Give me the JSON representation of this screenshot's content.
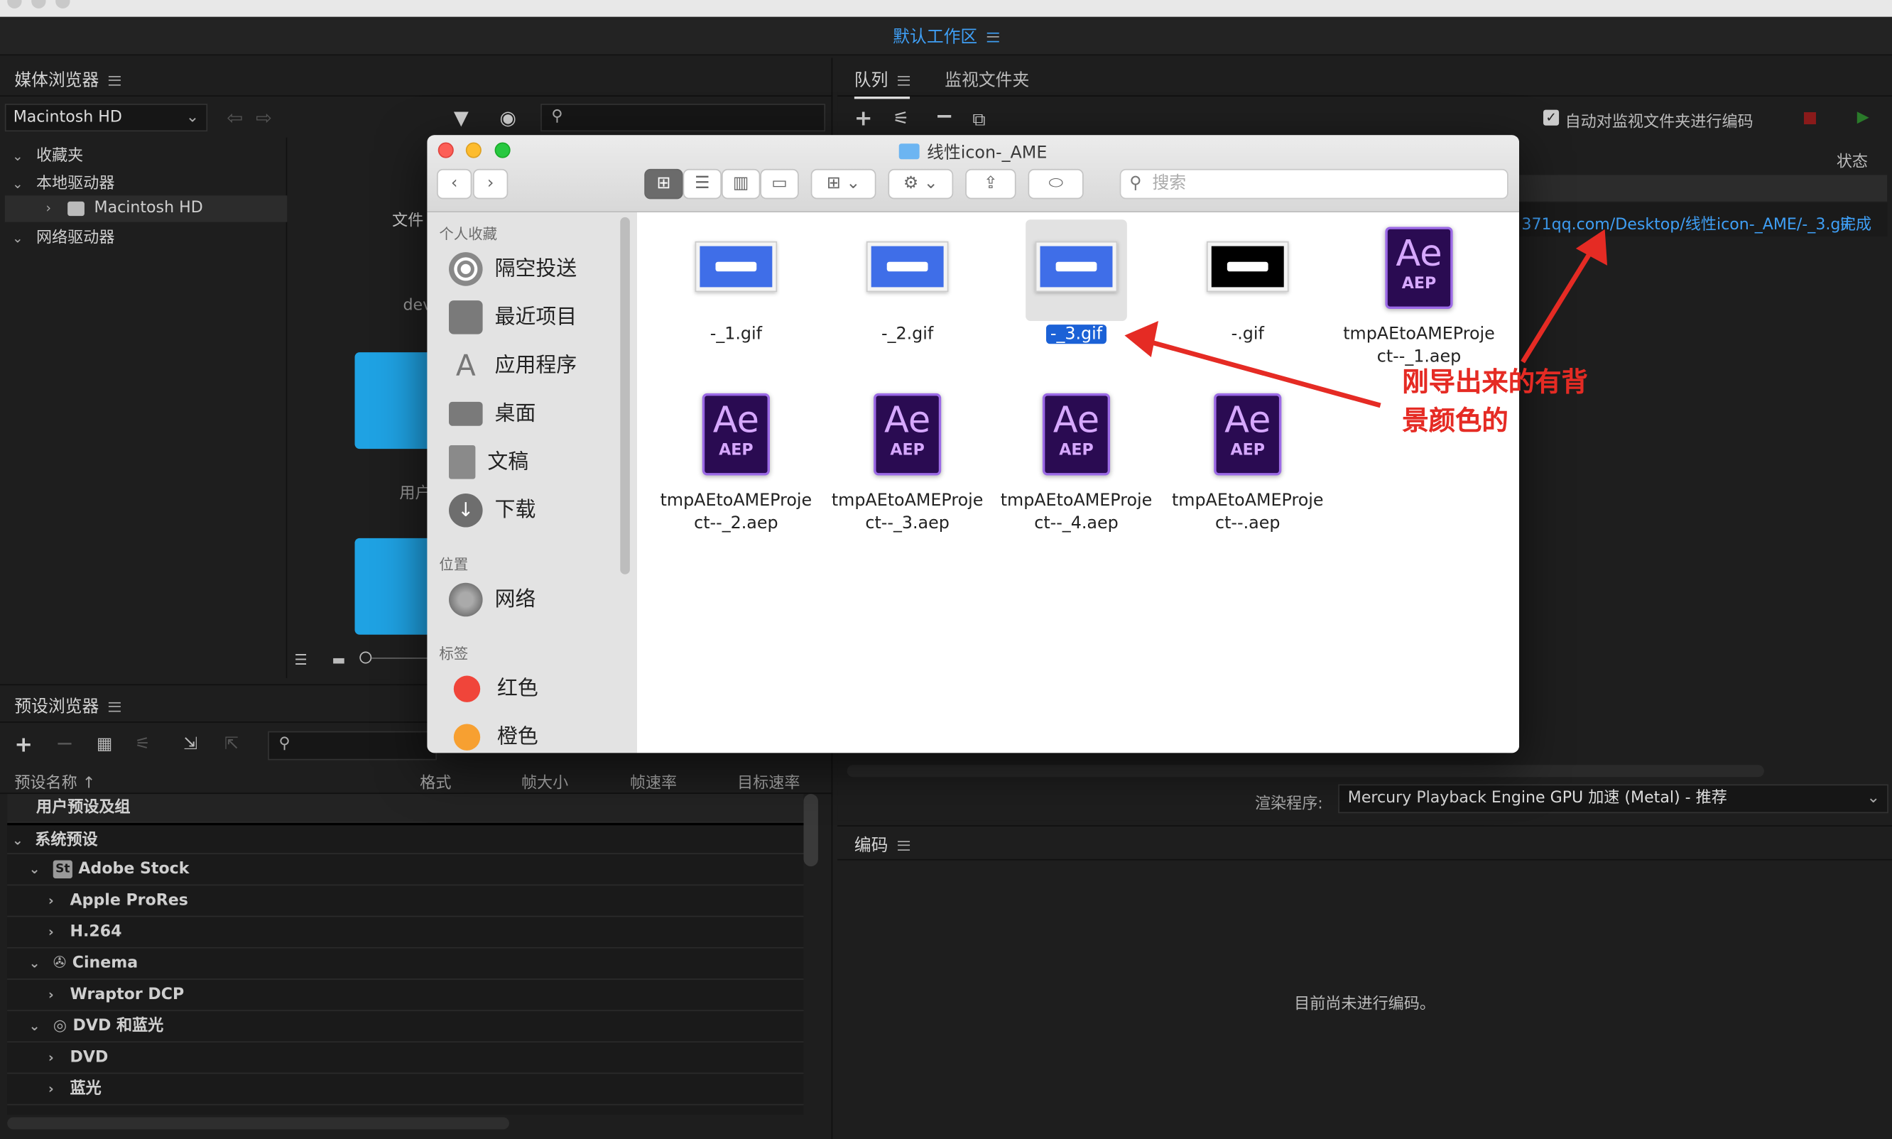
{
  "workspace": {
    "title": "默认工作区"
  },
  "media_browser": {
    "title": "媒体浏览器",
    "drive_select": "Macintosh HD",
    "tree": [
      {
        "label": "收藏夹"
      },
      {
        "label": "本地驱动器"
      },
      {
        "label": "Macintosh HD"
      },
      {
        "label": "网络驱动器"
      }
    ],
    "partial_labels": {
      "a": "文件",
      "b": "dev",
      "c": "用户"
    }
  },
  "queue": {
    "tabs": [
      {
        "label": "队列"
      },
      {
        "label": "监视文件夹"
      }
    ],
    "auto_encode_label": "自动对监视文件夹进行编码",
    "status_col": "状态",
    "output_path": "371qq.com/Desktop/线性icon-_AME/-_3.gif",
    "status": "完成",
    "renderer_label": "渲染程序:",
    "renderer_value": "Mercury Playback Engine GPU 加速 (Metal) - 推荐"
  },
  "encoding": {
    "title": "编码",
    "empty_text": "目前尚未进行编码。"
  },
  "preset_browser": {
    "title": "预设浏览器",
    "columns": [
      "预设名称 ↑",
      "格式",
      "帧大小",
      "帧速率",
      "目标速率"
    ],
    "rows": [
      {
        "label": "用户预设及组"
      },
      {
        "label": "系统预设"
      },
      {
        "label": "Adobe Stock"
      },
      {
        "label": "Apple ProRes"
      },
      {
        "label": "H.264"
      },
      {
        "label": "Cinema"
      },
      {
        "label": "Wraptor DCP"
      },
      {
        "label": "DVD 和蓝光"
      },
      {
        "label": "DVD"
      },
      {
        "label": "蓝光"
      }
    ]
  },
  "finder": {
    "title": "线性icon-_AME",
    "search_placeholder": "搜索",
    "sidebar": {
      "favorites_header": "个人收藏",
      "favorites": [
        {
          "label": "隔空投送",
          "icon": "airdrop-icon"
        },
        {
          "label": "最近项目",
          "icon": "recents-icon"
        },
        {
          "label": "应用程序",
          "icon": "applications-icon"
        },
        {
          "label": "桌面",
          "icon": "desktop-icon"
        },
        {
          "label": "文稿",
          "icon": "documents-icon"
        },
        {
          "label": "下载",
          "icon": "downloads-icon"
        }
      ],
      "locations_header": "位置",
      "locations": [
        {
          "label": "网络",
          "icon": "network-icon"
        }
      ],
      "tags_header": "标签",
      "tags": [
        {
          "label": "红色",
          "color": "#f0453a"
        },
        {
          "label": "橙色",
          "color": "#f7a031"
        }
      ]
    },
    "files": [
      {
        "name": "-_1.gif",
        "kind": "gif"
      },
      {
        "name": "-_2.gif",
        "kind": "gif"
      },
      {
        "name": "-_3.gif",
        "kind": "gif",
        "selected": true
      },
      {
        "name": "-.gif",
        "kind": "gif-black"
      },
      {
        "name": "tmpAEtoAMEProject--_1.aep",
        "line1": "tmpAEtoAMEProje",
        "line2": "ct--_1.aep",
        "kind": "aep"
      },
      {
        "name": "tmpAEtoAMEProject--_2.aep",
        "line1": "tmpAEtoAMEProje",
        "line2": "ct--_2.aep",
        "kind": "aep"
      },
      {
        "name": "tmpAEtoAMEProject--_3.aep",
        "line1": "tmpAEtoAMEProje",
        "line2": "ct--_3.aep",
        "kind": "aep"
      },
      {
        "name": "tmpAEtoAMEProject--_4.aep",
        "line1": "tmpAEtoAMEProje",
        "line2": "ct--_4.aep",
        "kind": "aep"
      },
      {
        "name": "tmpAEtoAMEProject--.aep",
        "line1": "tmpAEtoAMEProje",
        "line2": "ct--.aep",
        "kind": "aep"
      }
    ],
    "ae_icon_text": {
      "big": "Ae",
      "small": "AEP"
    }
  },
  "annotation": {
    "line1": "刚导出来的有背",
    "line2": "景颜色的",
    "color": "#e52b24"
  }
}
